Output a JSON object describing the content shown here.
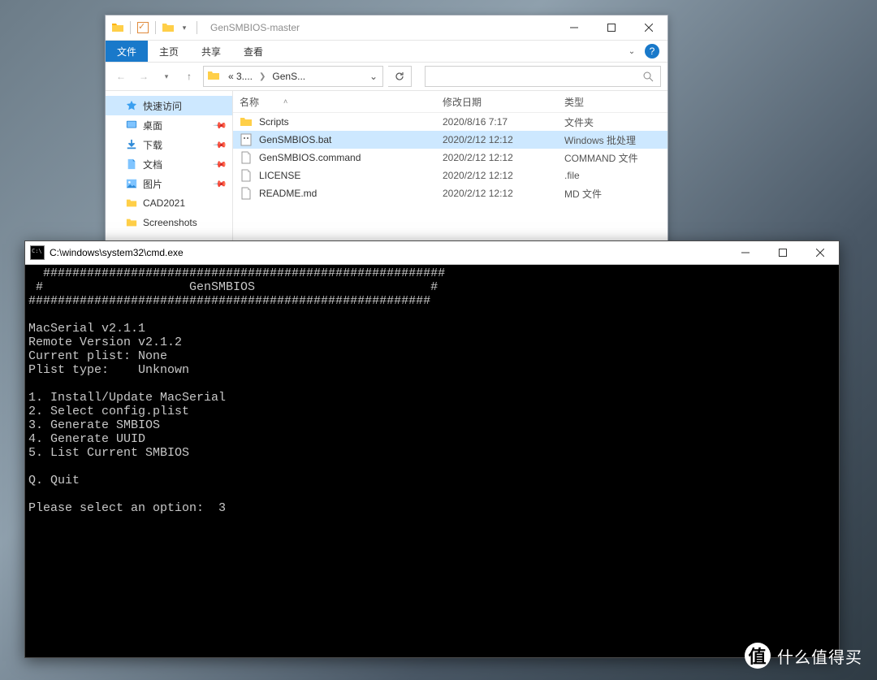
{
  "explorer": {
    "title": "GenSMBIOS-master",
    "ribbon": {
      "tabs": [
        "文件",
        "主页",
        "共享",
        "查看"
      ],
      "active_index": 0
    },
    "breadcrumb": {
      "seg1": "«  3....",
      "seg2": "GenS..."
    },
    "nav": {
      "items": [
        {
          "label": "快速访问",
          "icon": "star",
          "selected": true,
          "pin": false
        },
        {
          "label": "桌面",
          "icon": "desk",
          "selected": false,
          "pin": true
        },
        {
          "label": "下载",
          "icon": "dl",
          "selected": false,
          "pin": true
        },
        {
          "label": "文档",
          "icon": "doc",
          "selected": false,
          "pin": true
        },
        {
          "label": "图片",
          "icon": "pic",
          "selected": false,
          "pin": true
        },
        {
          "label": "CAD2021",
          "icon": "fold",
          "selected": false,
          "pin": false
        },
        {
          "label": "Screenshots",
          "icon": "fold",
          "selected": false,
          "pin": false
        }
      ]
    },
    "columns": {
      "name": "名称",
      "date": "修改日期",
      "type": "类型"
    },
    "files": [
      {
        "name": "Scripts",
        "date": "2020/8/16 7:17",
        "type": "文件夹",
        "icon": "folder",
        "selected": false
      },
      {
        "name": "GenSMBIOS.bat",
        "date": "2020/2/12 12:12",
        "type": "Windows 批处理",
        "icon": "bat",
        "selected": true
      },
      {
        "name": "GenSMBIOS.command",
        "date": "2020/2/12 12:12",
        "type": "COMMAND 文件",
        "icon": "file",
        "selected": false
      },
      {
        "name": "LICENSE",
        "date": "2020/2/12 12:12",
        "type": ".file",
        "icon": "file",
        "selected": false
      },
      {
        "name": "README.md",
        "date": "2020/2/12 12:12",
        "type": "MD 文件",
        "icon": "file",
        "selected": false
      }
    ]
  },
  "cmd": {
    "title": "C:\\windows\\system32\\cmd.exe",
    "lines": [
      "  #######################################################",
      " #                    GenSMBIOS                        #",
      "#######################################################",
      "",
      "MacSerial v2.1.1",
      "Remote Version v2.1.2",
      "Current plist: None",
      "Plist type:    Unknown",
      "",
      "1. Install/Update MacSerial",
      "2. Select config.plist",
      "3. Generate SMBIOS",
      "4. Generate UUID",
      "5. List Current SMBIOS",
      "",
      "Q. Quit",
      "",
      "Please select an option:  3"
    ]
  },
  "watermark": {
    "text": "什么值得买",
    "logo": "值"
  }
}
